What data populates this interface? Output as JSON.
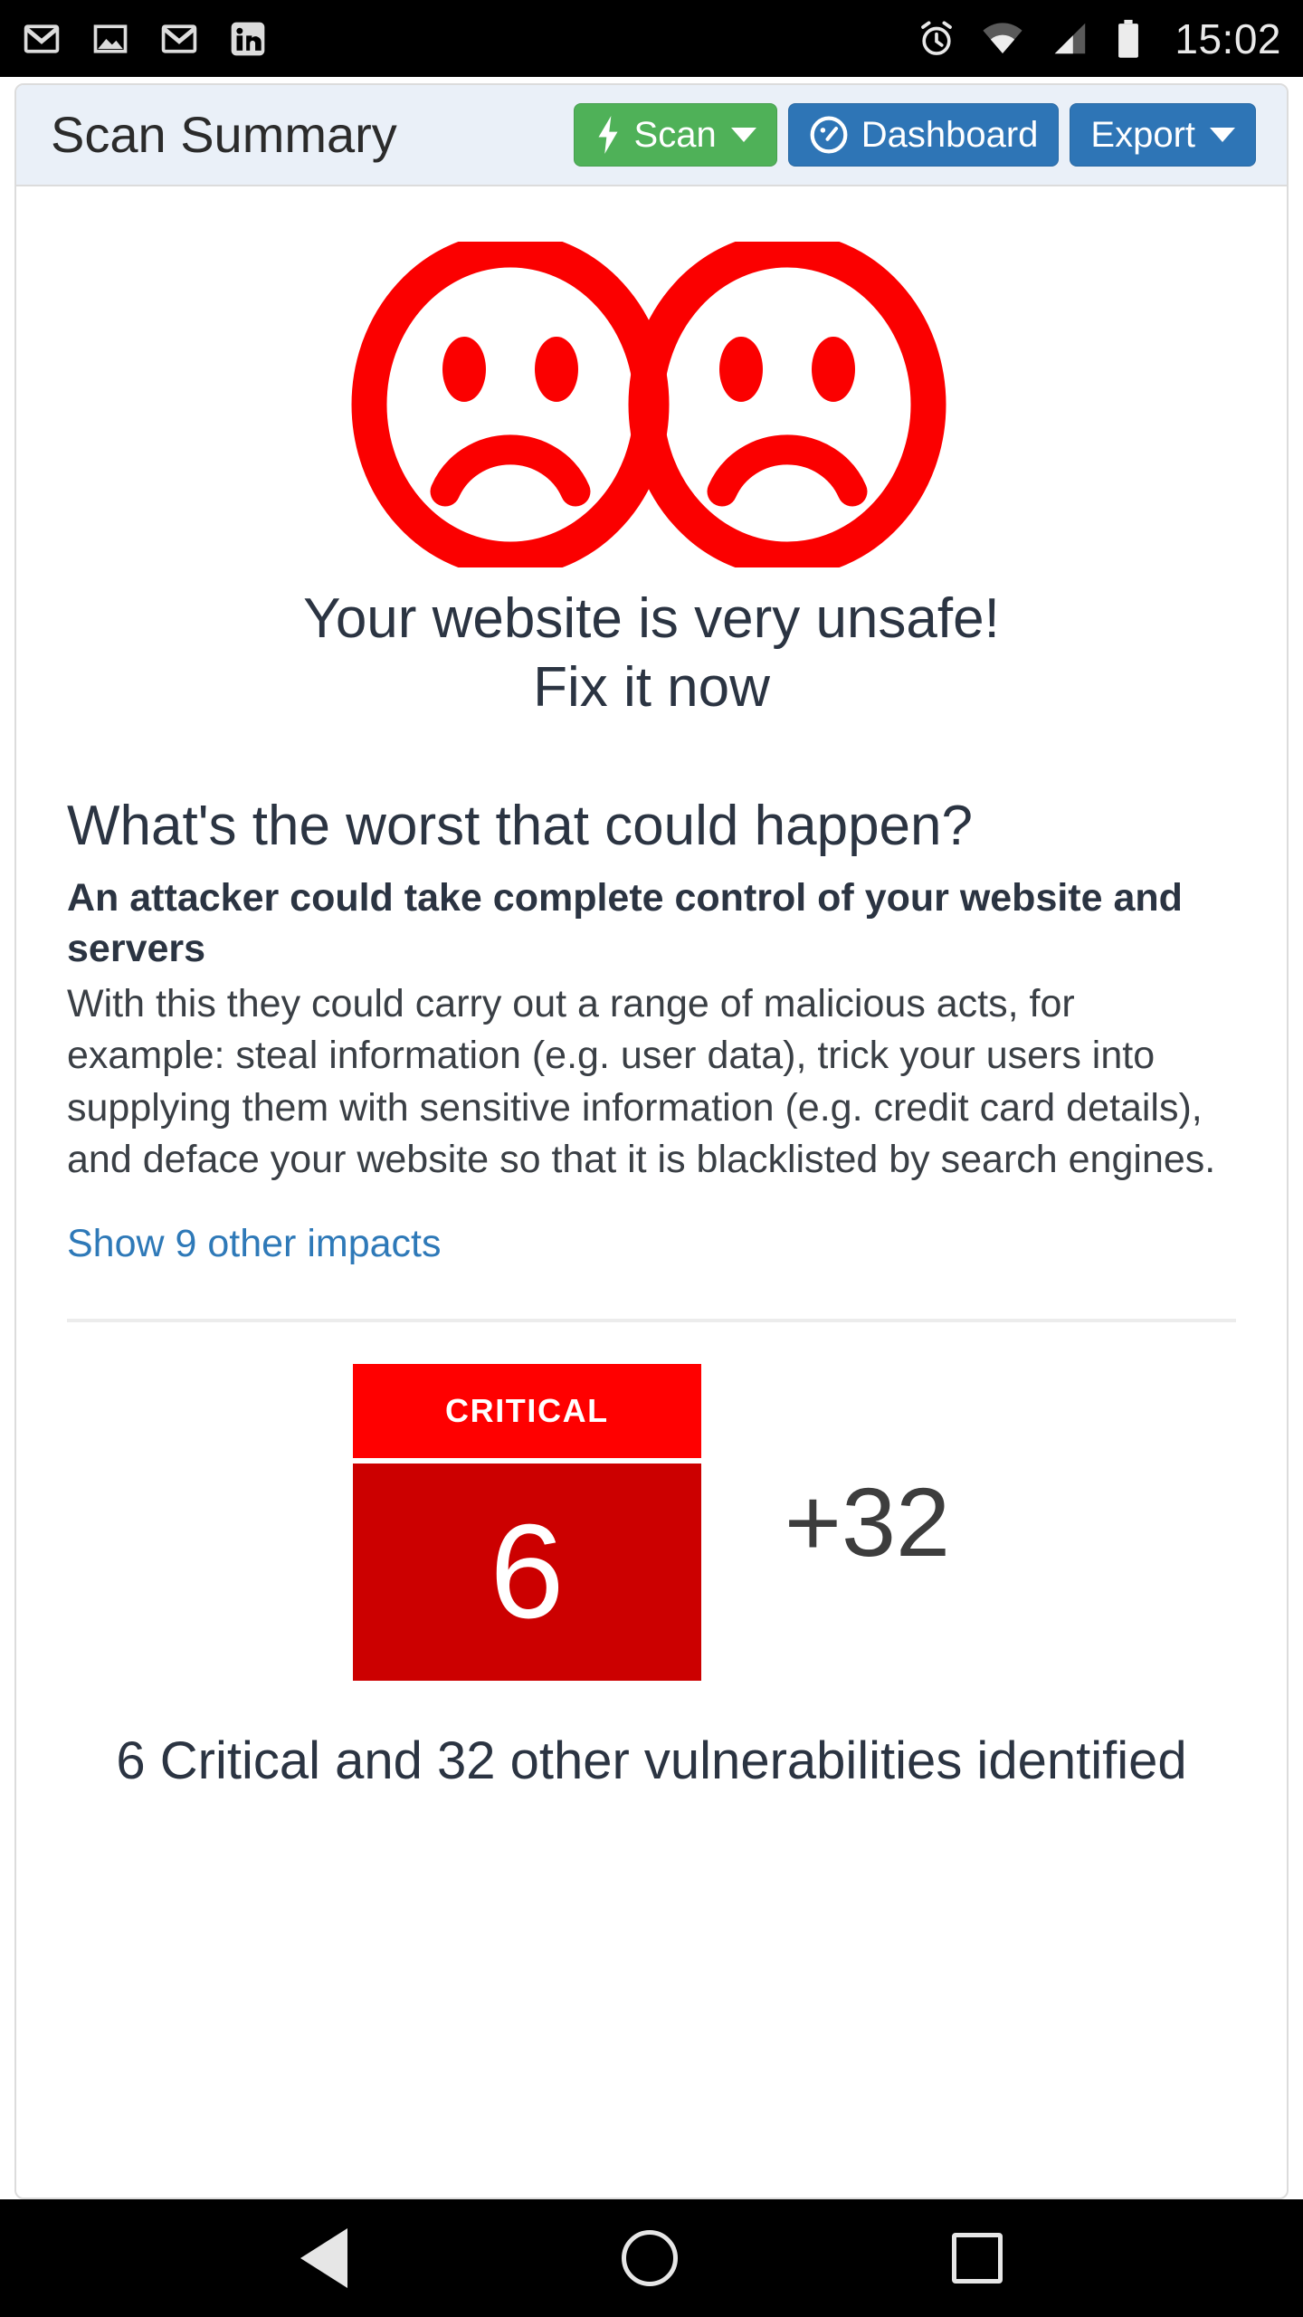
{
  "status_bar": {
    "time": "15:02",
    "left_icons": [
      "gmail-icon",
      "photo-icon",
      "gmail-icon",
      "linkedin-icon"
    ],
    "right_icons": [
      "alarm-icon",
      "wifi-icon",
      "cellular-signal-icon",
      "battery-icon"
    ]
  },
  "header": {
    "title": "Scan Summary",
    "scan_label": "Scan",
    "dashboard_label": "Dashboard",
    "export_label": "Export"
  },
  "status": {
    "face_icon": "sad-face-icon",
    "headline_line1": "Your website is very unsafe!",
    "headline_line2": "Fix it now"
  },
  "impact": {
    "section_title": "What's the worst that could happen?",
    "lead": "An attacker could take complete control of your website and servers",
    "body": "With this they could carry out a range of malicious acts, for example: steal information (e.g. user data), trick your users into supplying them with sensitive information (e.g. credit card details), and deface your website so that it is blacklisted by search engines.",
    "more_link": "Show 9 other impacts"
  },
  "severity": {
    "label": "CRITICAL",
    "count": "6",
    "others": "+32",
    "summary": "6 Critical and 32 other vulnerabilities identified",
    "critical_header_color": "#ff0000",
    "critical_body_color": "#cc0000"
  },
  "nav_bar": {
    "back": "back-triangle-icon",
    "home": "home-circle-icon",
    "recents": "recents-square-icon"
  }
}
